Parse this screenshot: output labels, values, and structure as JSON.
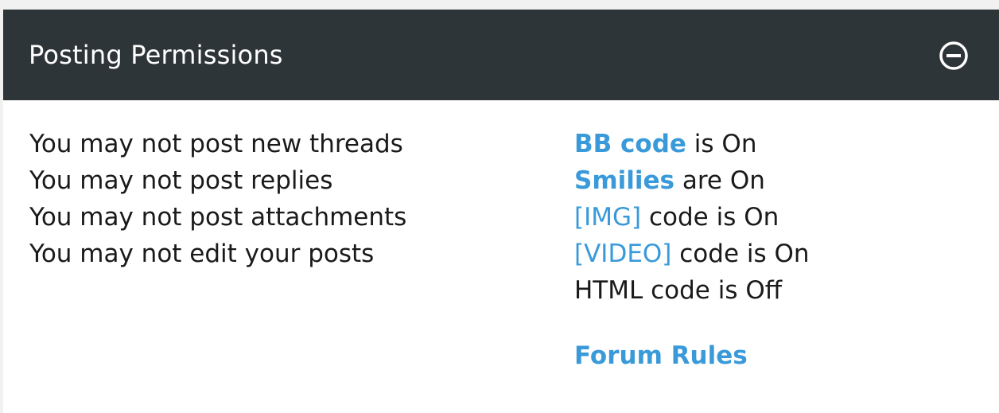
{
  "panel": {
    "title": "Posting Permissions",
    "collapse_icon": "minus-circle-icon"
  },
  "permissions": [
    "You may not post new threads",
    "You may not post replies",
    "You may not post attachments",
    "You may not edit your posts"
  ],
  "settings": [
    {
      "link": "BB code",
      "text": " is On"
    },
    {
      "link": "Smilies",
      "text": " are On"
    },
    {
      "link": "[IMG]",
      "text": " code is On"
    },
    {
      "link": "[VIDEO]",
      "text": " code is On"
    },
    {
      "link": "",
      "text": "HTML code is Off"
    }
  ],
  "forum_rules": "Forum Rules",
  "colors": {
    "header_bg": "#2e3539",
    "link": "#3a9ad9",
    "text": "#1a1a1a"
  }
}
